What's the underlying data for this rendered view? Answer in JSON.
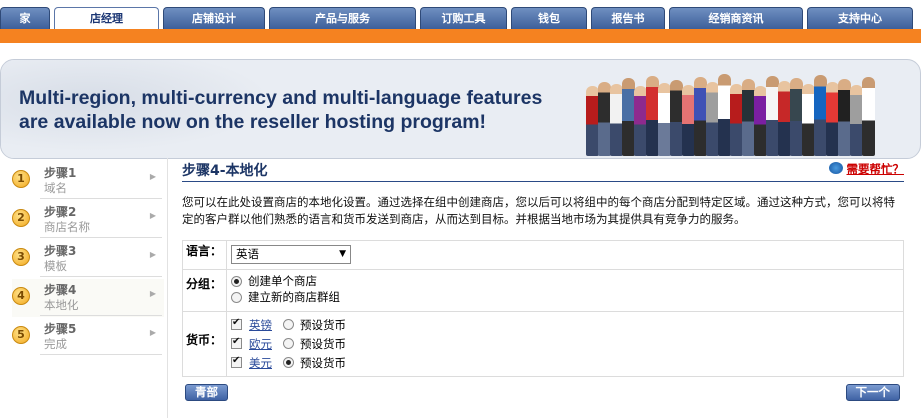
{
  "nav": {
    "tabs": [
      {
        "label": "家"
      },
      {
        "label": "店经理"
      },
      {
        "label": "店铺设计"
      },
      {
        "label": "产品与服务"
      },
      {
        "label": "订购工具"
      },
      {
        "label": "钱包"
      },
      {
        "label": "报告书"
      },
      {
        "label": "经销商资讯"
      },
      {
        "label": "支持中心"
      }
    ],
    "active_index": 1,
    "accent_color": "#f58220"
  },
  "banner": {
    "line1": "Multi-region, multi-currency and multi-language features",
    "line2": "are available now on the reseller hosting program!"
  },
  "steps": [
    {
      "number": "1",
      "title": "步骤1",
      "subtitle": "域名"
    },
    {
      "number": "2",
      "title": "步骤2",
      "subtitle": "商店名称"
    },
    {
      "number": "3",
      "title": "步骤3",
      "subtitle": "模板"
    },
    {
      "number": "4",
      "title": "步骤4",
      "subtitle": "本地化"
    },
    {
      "number": "5",
      "title": "步骤5",
      "subtitle": "完成"
    }
  ],
  "main": {
    "heading": "步骤4-本地化",
    "help_link": "需要帮忙？",
    "description": "您可以在此处设置商店的本地化设置。通过选择在组中创建商店，您以后可以将组中的每个商店分配到特定区域。通过这种方式，您可以将特定的客户群以他们熟悉的语言和货币发送到商店，从而达到目标。并根据当地市场为其提供具有竞争力的服务。",
    "language": {
      "label": "语言：",
      "value": "英语"
    },
    "group": {
      "label": "分组：",
      "options": [
        {
          "label": "创建单个商店",
          "selected": true
        },
        {
          "label": "建立新的商店群组",
          "selected": false
        }
      ]
    },
    "currency": {
      "label": "货币：",
      "items": [
        {
          "name": "英镑",
          "checked": true,
          "default_label": "预设货币",
          "default": false
        },
        {
          "name": "欧元",
          "checked": true,
          "default_label": "预设货币",
          "default": false
        },
        {
          "name": "美元",
          "checked": true,
          "default_label": "预设货币",
          "default": true
        }
      ]
    },
    "back_button": "青部",
    "next_button": "下一个"
  }
}
